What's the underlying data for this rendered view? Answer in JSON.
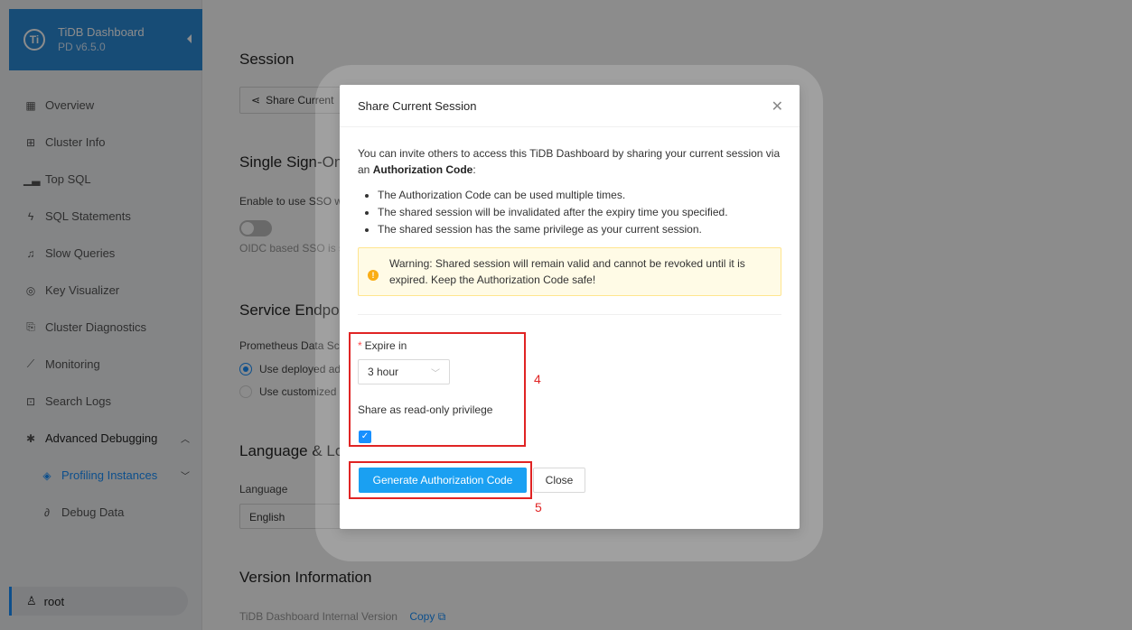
{
  "sidebar": {
    "brand_title": "TiDB Dashboard",
    "brand_version": "PD v6.5.0",
    "brand_logo": "Ti",
    "items": [
      {
        "label": "Overview",
        "icon": "grid-icon"
      },
      {
        "label": "Cluster Info",
        "icon": "cluster-icon"
      },
      {
        "label": "Top SQL",
        "icon": "chart-icon"
      },
      {
        "label": "SQL Statements",
        "icon": "thunder-icon"
      },
      {
        "label": "Slow Queries",
        "icon": "bell-icon"
      },
      {
        "label": "Key Visualizer",
        "icon": "eye-icon"
      },
      {
        "label": "Cluster Diagnostics",
        "icon": "file-icon"
      },
      {
        "label": "Monitoring",
        "icon": "line-chart-icon"
      },
      {
        "label": "Search Logs",
        "icon": "search-file-icon"
      },
      {
        "label": "Advanced Debugging",
        "icon": "bug-icon"
      },
      {
        "label": "Profiling Instances",
        "icon": "aim-icon"
      },
      {
        "label": "Debug Data",
        "icon": "link-icon"
      }
    ],
    "user": "root"
  },
  "main": {
    "session_title": "Session",
    "share_button": "Share Current",
    "sso_title": "Single Sign-On",
    "sso_enable": "Enable to use SSO w",
    "sso_note": "OIDC based SSO is s",
    "endpoint_title": "Service Endpoi",
    "prometheus_label": "Prometheus Data Sc",
    "radio_deployed": "Use deployed ad",
    "radio_custom": "Use customized",
    "lang_title": "Language & Lo",
    "lang_label": "Language",
    "lang_value": "English",
    "version_title": "Version Information",
    "version_label": "TiDB Dashboard Internal Version",
    "copy_link": "Copy"
  },
  "modal": {
    "title": "Share Current Session",
    "intro": "You can invite others to access this TiDB Dashboard by sharing your current session via an",
    "intro_bold": "Authorization Code",
    "intro_end": ":",
    "bullets": [
      "The Authorization Code can be used multiple times.",
      "The shared session will be invalidated after the expiry time you specified.",
      "The shared session has the same privilege as your current session."
    ],
    "warning": "Warning: Shared session will remain valid and cannot be revoked until it is expired. Keep the Authorization Code safe!",
    "expire_label": "Expire in",
    "expire_value": "3 hour",
    "readonly_label": "Share as read-only privilege",
    "readonly_checked": true,
    "generate_button": "Generate Authorization Code",
    "close_button": "Close"
  },
  "annotations": {
    "step4": "4",
    "step5": "5",
    "color": "#e02424"
  },
  "colors": {
    "brand": "#2b8ad8",
    "primary": "#1aa0f2",
    "warning_bg": "#fffbe6"
  }
}
